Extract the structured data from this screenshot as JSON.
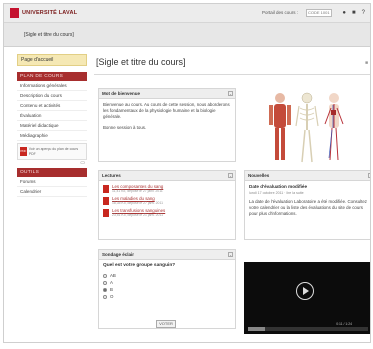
{
  "topbar": {
    "logo_text": "UNIVERSITÉ LAVAL",
    "portal_label": "Portail des cours :",
    "portal_select": "CODE 1001",
    "icons": [
      "user-icon",
      "home-icon",
      "help-icon"
    ]
  },
  "course_bar": {
    "title": "[Sigle et titre du cours]"
  },
  "sidebar": {
    "home": "Page d'accueil",
    "plan_head": "PLAN DE COURS",
    "plan_items": [
      "Informations générales",
      "Description du cours",
      "Contenu et activités",
      "Évaluation",
      "Matériel didactique",
      "Médiagraphie"
    ],
    "pdf_text": "Voir un aperçu du plan de cours PDF",
    "outils_head": "OUTILS",
    "outils_items": [
      "Forums",
      "Calendrier"
    ]
  },
  "main": {
    "title": "[Sigle et titre du cours]",
    "welcome": {
      "heading": "Mot de bienvenue",
      "body": "Bienvenue au cours. Au cours de cette session, nous aborderons les fondamentaux de la physiologie humaine et la biologie générale.",
      "sign": "Bonne session à tous."
    },
    "lectures": {
      "heading": "Lectures",
      "items": [
        {
          "title": "Les composantes du sang",
          "meta": "11,41 Ko, déposé le 27 janv. 2011"
        },
        {
          "title": "Les maladies du sang",
          "meta": "18,35 Ko, déposé le 27 janv. 2011"
        },
        {
          "title": "Les transfusions sanguines",
          "meta": "23,51 Ko, déposé le 21 janv. 2011"
        }
      ]
    },
    "news": {
      "heading": "Nouvelles",
      "title": "Date d'évaluation modifiée",
      "date": "lundi 17 octobre 2011 · lire la suite",
      "body": "La date de l'évaluation Laboratoire a été modifiée. Consultez votre calendrier ou la liste des évaluations du site de cours pour plus d'informations."
    },
    "poll": {
      "heading": "Sondage éclair",
      "question": "Quel est votre groupe sanguin?",
      "options": [
        "AB",
        "A",
        "B",
        "O"
      ],
      "selected": "B",
      "button": "VOTER"
    },
    "video": {
      "time": "0:11 / 1:24",
      "progress": 0.14
    }
  }
}
